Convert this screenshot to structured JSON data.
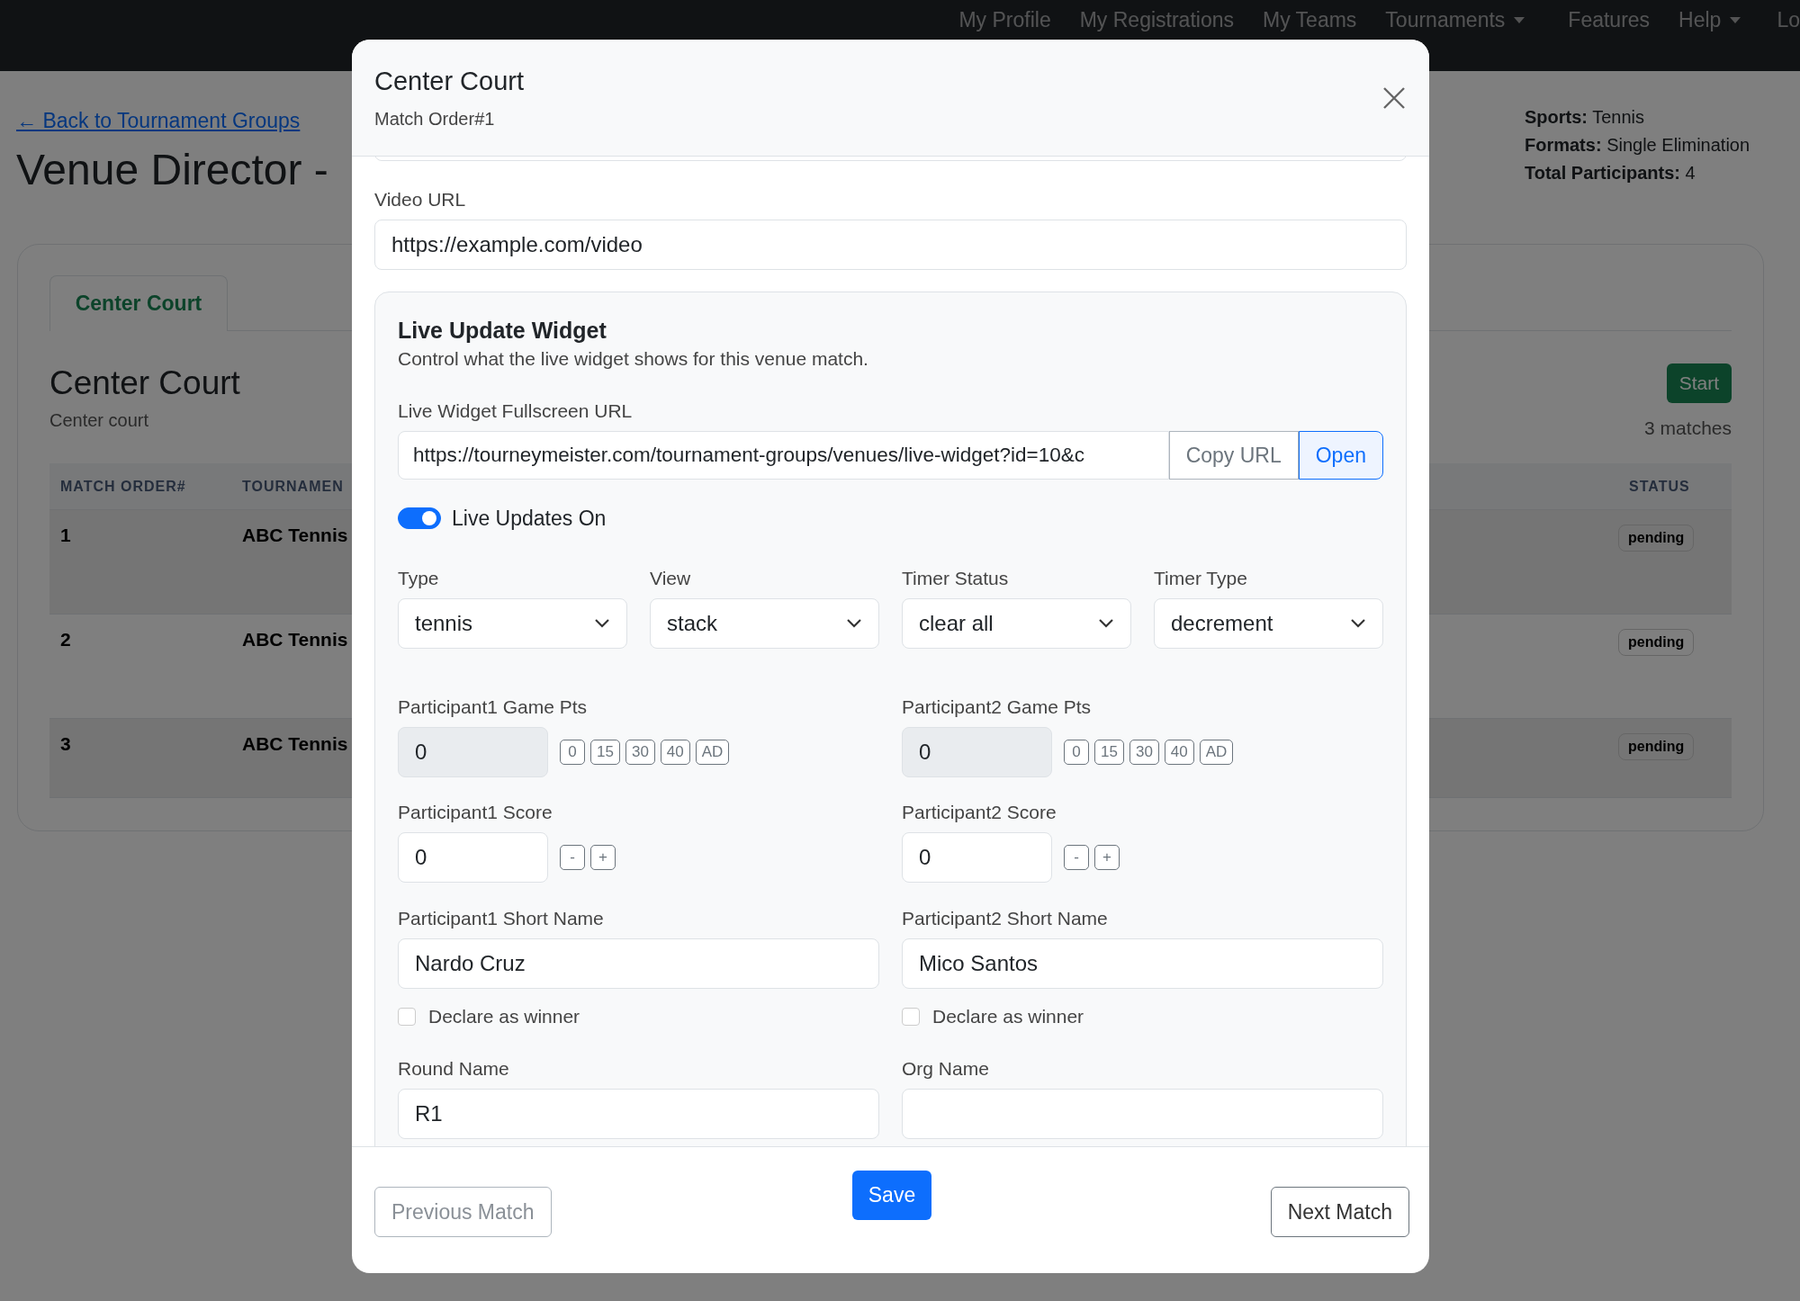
{
  "navbar": {
    "items": [
      {
        "label": "My Profile",
        "dropdown": false
      },
      {
        "label": "My Registrations",
        "dropdown": false
      },
      {
        "label": "My Teams",
        "dropdown": false
      },
      {
        "label": "Tournaments",
        "dropdown": true
      },
      {
        "label": "Features",
        "dropdown": false
      },
      {
        "label": "Help",
        "dropdown": true
      },
      {
        "label": "Lo",
        "dropdown": false
      }
    ]
  },
  "page": {
    "back_link": "← Back to Tournament Groups",
    "title": "Venue Director -",
    "info": [
      {
        "label": "Sports:",
        "value": "Tennis"
      },
      {
        "label": "Formats:",
        "value": "Single Elimination"
      },
      {
        "label": "Total Participants:",
        "value": "4"
      }
    ]
  },
  "venue_card": {
    "tabs": [
      {
        "label": "Center Court",
        "selected": true
      }
    ],
    "heading": "Center Court",
    "subheading": "Center court",
    "start_button": "Start",
    "match_count": "3 matches",
    "table": {
      "columns": [
        "MATCH ORDER#",
        "TOURNAMEN",
        "STATUS"
      ],
      "rows": [
        {
          "order": "1",
          "tournament": "ABC Tennis",
          "status": "pending"
        },
        {
          "order": "2",
          "tournament": "ABC Tennis",
          "status": "pending"
        },
        {
          "order": "3",
          "tournament": "ABC Tennis",
          "status": "pending"
        }
      ]
    }
  },
  "modal": {
    "title": "Center Court",
    "subtitle": "Match Order#1",
    "video_url": {
      "label": "Video URL",
      "value": "https://example.com/video"
    },
    "widget": {
      "title": "Live Update Widget",
      "description": "Control what the live widget shows for this venue match.",
      "url_label": "Live Widget Fullscreen URL",
      "url_value": "https://tourneymeister.com/tournament-groups/venues/live-widget?id=10&c",
      "copy_button": "Copy URL",
      "open_button": "Open",
      "live_toggle": {
        "label": "Live Updates On",
        "on": true
      },
      "selects": [
        {
          "label": "Type",
          "value": "tennis"
        },
        {
          "label": "View",
          "value": "stack"
        },
        {
          "label": "Timer Status",
          "value": "clear all"
        },
        {
          "label": "Timer Type",
          "value": "decrement"
        }
      ],
      "participants": [
        {
          "game_pts_label": "Participant1 Game Pts",
          "game_pts": "0",
          "pt_buttons": [
            "0",
            "15",
            "30",
            "40",
            "AD"
          ],
          "score_label": "Participant1 Score",
          "score": "0",
          "score_buttons": [
            "-",
            "+"
          ],
          "short_name_label": "Participant1 Short Name",
          "short_name": "Nardo Cruz",
          "winner_label": "Declare as winner",
          "winner": false
        },
        {
          "game_pts_label": "Participant2 Game Pts",
          "game_pts": "0",
          "pt_buttons": [
            "0",
            "15",
            "30",
            "40",
            "AD"
          ],
          "score_label": "Participant2 Score",
          "score": "0",
          "score_buttons": [
            "-",
            "+"
          ],
          "short_name_label": "Participant2 Short Name",
          "short_name": "Mico Santos",
          "winner_label": "Declare as winner",
          "winner": false
        }
      ],
      "round_name": {
        "label": "Round Name",
        "value": "R1"
      },
      "org_name": {
        "label": "Org Name"
      }
    },
    "footer": {
      "previous": {
        "label": "Previous Match",
        "disabled": true
      },
      "save": "Save",
      "next": "Next Match"
    }
  }
}
